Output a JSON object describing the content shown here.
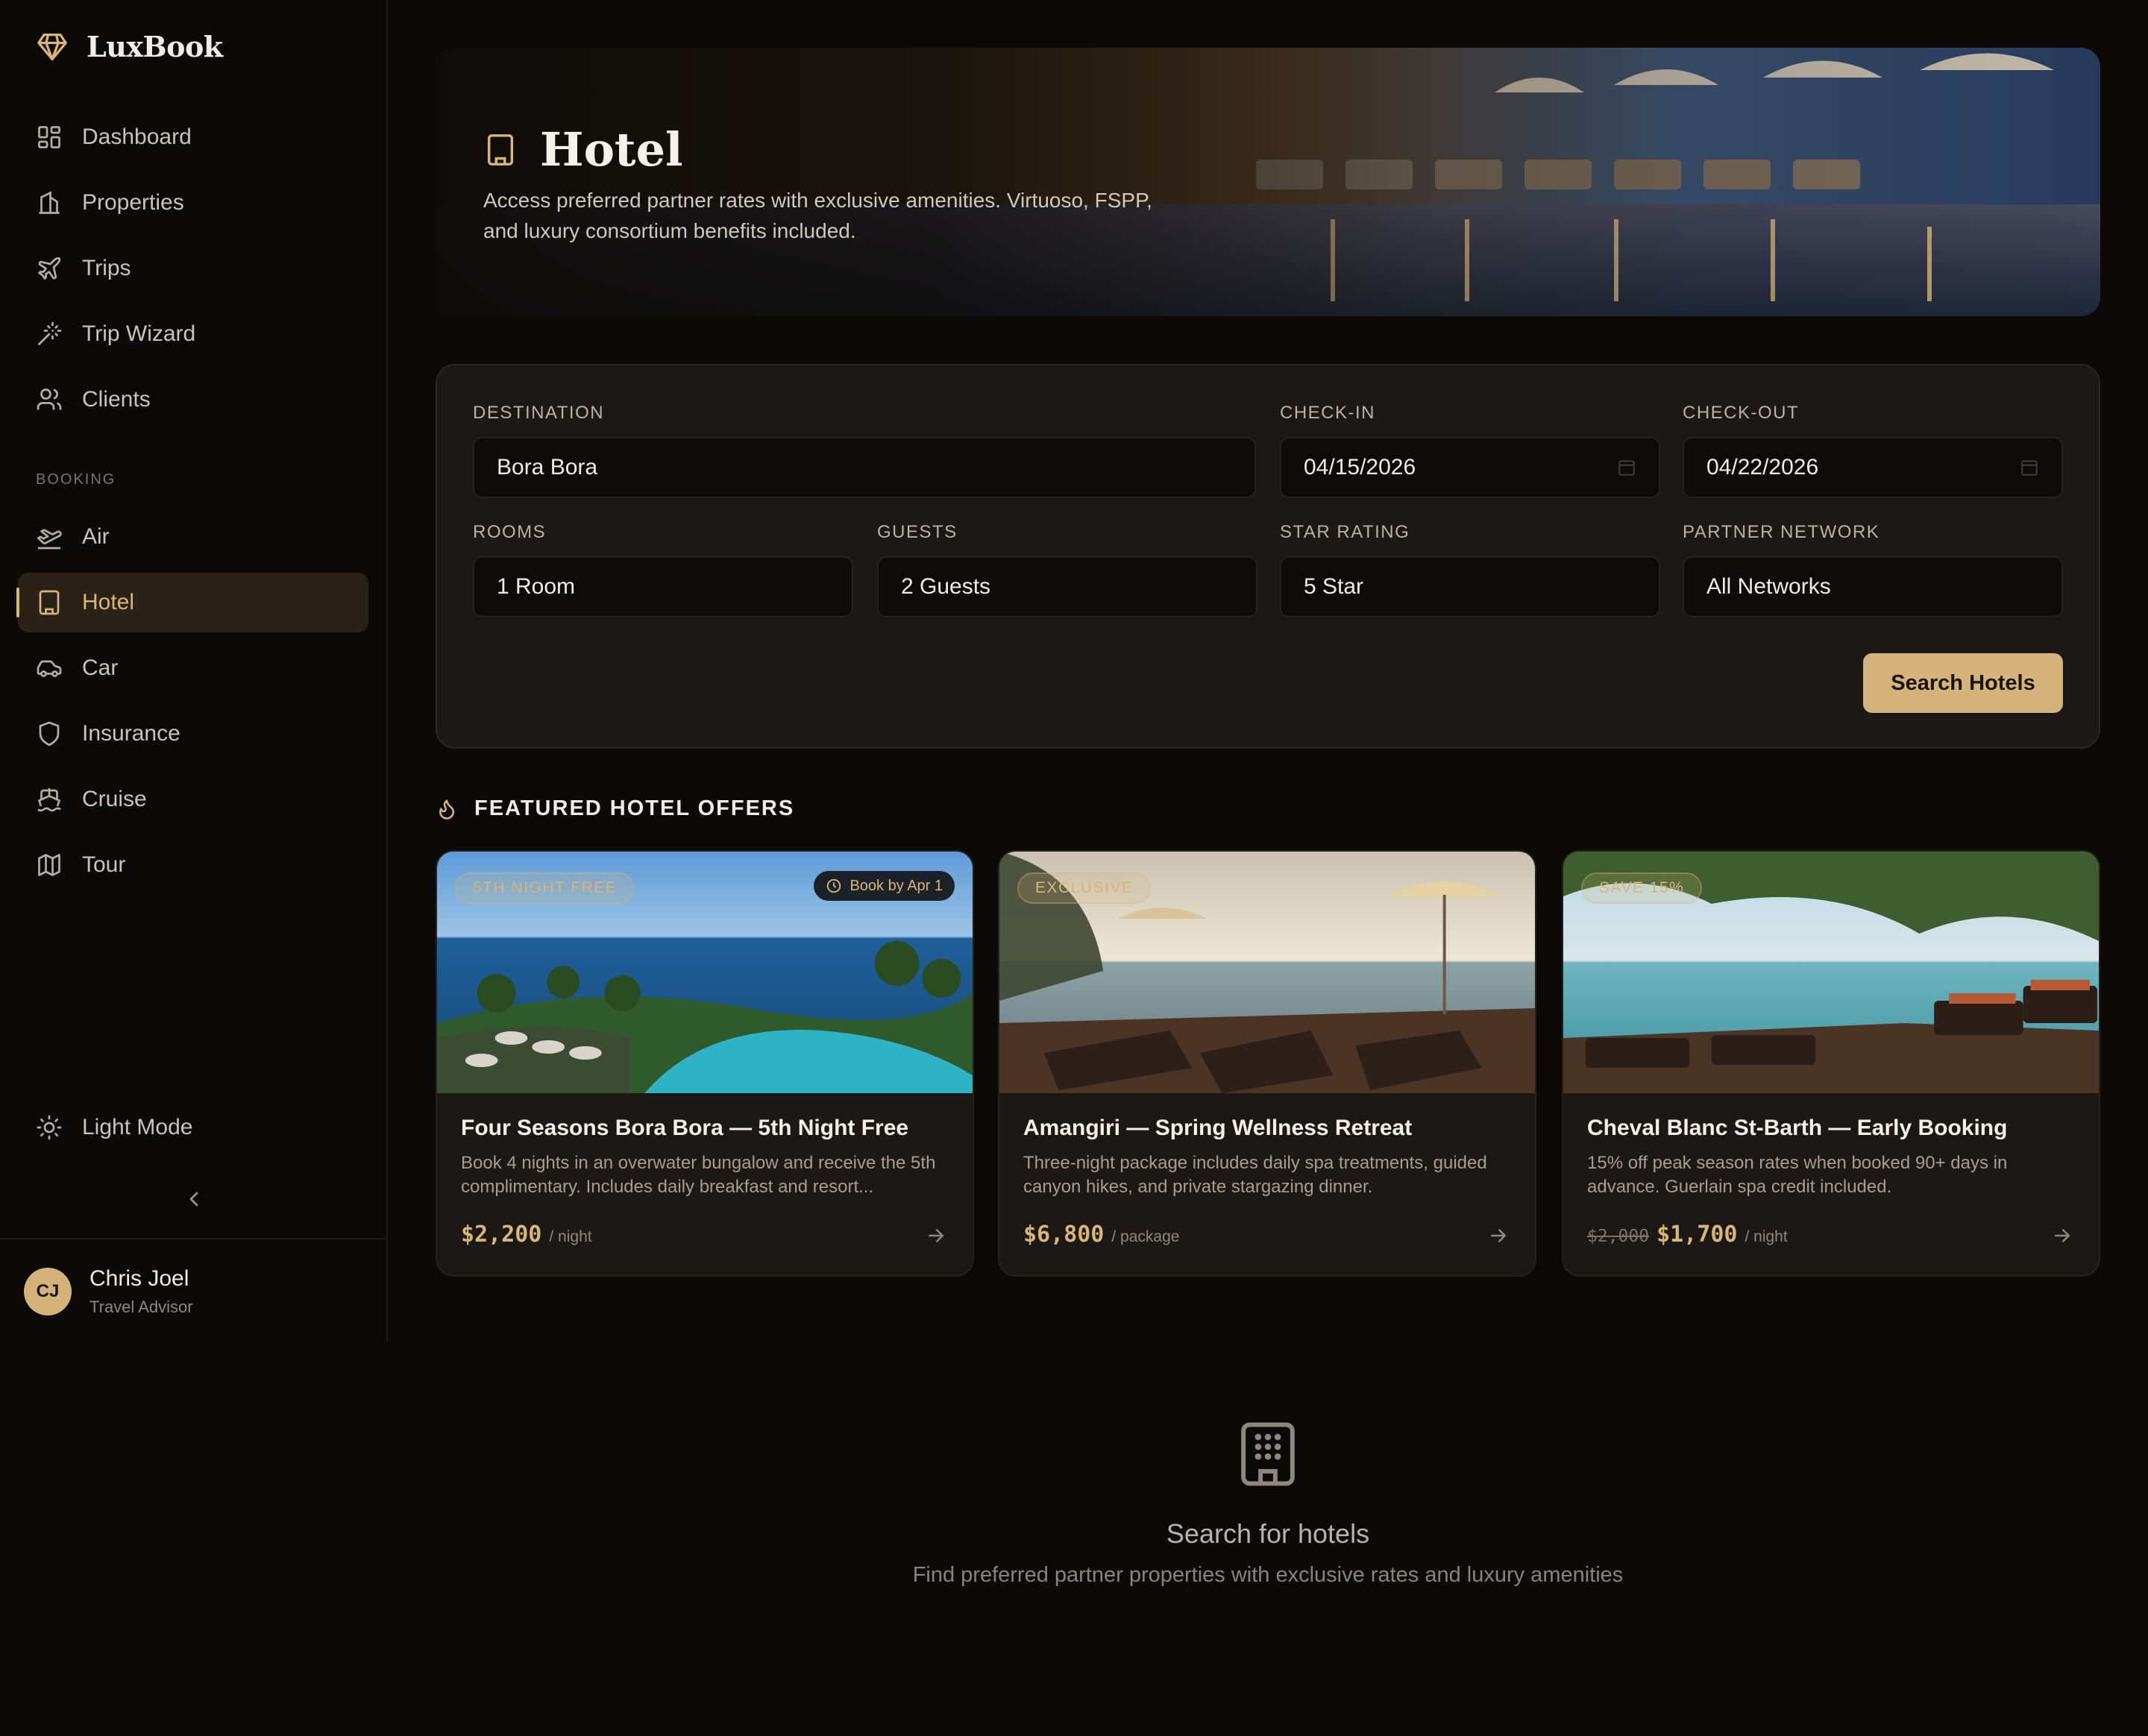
{
  "brand": {
    "name": "LuxBook",
    "icon": "gem-icon"
  },
  "sidebar": {
    "main_items": [
      {
        "label": "Dashboard",
        "icon": "grid-icon"
      },
      {
        "label": "Properties",
        "icon": "building-icon"
      },
      {
        "label": "Trips",
        "icon": "plane-icon"
      },
      {
        "label": "Trip Wizard",
        "icon": "wand-icon"
      },
      {
        "label": "Clients",
        "icon": "users-icon"
      }
    ],
    "section_label": "BOOKING",
    "booking_items": [
      {
        "label": "Air",
        "icon": "plane-takeoff-icon"
      },
      {
        "label": "Hotel",
        "icon": "hotel-icon",
        "active": true
      },
      {
        "label": "Car",
        "icon": "car-icon"
      },
      {
        "label": "Insurance",
        "icon": "shield-icon"
      },
      {
        "label": "Cruise",
        "icon": "ship-icon"
      },
      {
        "label": "Tour",
        "icon": "map-icon"
      }
    ],
    "light_mode_label": "Light Mode",
    "user": {
      "initials": "CJ",
      "name": "Chris Joel",
      "role": "Travel Advisor"
    }
  },
  "hero": {
    "title": "Hotel",
    "description": "Access preferred partner rates with exclusive amenities. Virtuoso, FSPP, and luxury consortium benefits included."
  },
  "search": {
    "destination": {
      "label": "DESTINATION",
      "value": "Bora Bora"
    },
    "check_in": {
      "label": "CHECK-IN",
      "value": "04/15/2026"
    },
    "check_out": {
      "label": "CHECK-OUT",
      "value": "04/22/2026"
    },
    "rooms": {
      "label": "ROOMS",
      "value": "1 Room"
    },
    "guests": {
      "label": "GUESTS",
      "value": "2 Guests"
    },
    "star_rating": {
      "label": "STAR RATING",
      "value": "5 Star"
    },
    "partner_network": {
      "label": "PARTNER NETWORK",
      "value": "All Networks"
    },
    "button_label": "Search Hotels"
  },
  "featured": {
    "title": "FEATURED HOTEL OFFERS",
    "offers": [
      {
        "badge": "5TH NIGHT FREE",
        "deadline": "Book by Apr 1",
        "title": "Four Seasons Bora Bora — 5th Night Free",
        "description": "Book 4 nights in an overwater bungalow and receive the 5th complimentary. Includes daily breakfast and resort...",
        "price_old": "",
        "price": "$2,200",
        "unit": "/ night"
      },
      {
        "badge": "EXCLUSIVE",
        "deadline": "",
        "title": "Amangiri — Spring Wellness Retreat",
        "description": "Three-night package includes daily spa treatments, guided canyon hikes, and private stargazing dinner.",
        "price_old": "",
        "price": "$6,800",
        "unit": "/ package"
      },
      {
        "badge": "SAVE 15%",
        "deadline": "",
        "title": "Cheval Blanc St-Barth — Early Booking",
        "description": "15% off peak season rates when booked 90+ days in advance. Guerlain spa credit included.",
        "price_old": "$2,000",
        "price": "$1,700",
        "unit": "/ night"
      }
    ]
  },
  "empty_state": {
    "title": "Search for hotels",
    "subtitle": "Find preferred partner properties with exclusive rates and luxury amenities"
  },
  "colors": {
    "accent": "#d8b578",
    "background": "#0b0a09",
    "panel": "#1b1815"
  }
}
